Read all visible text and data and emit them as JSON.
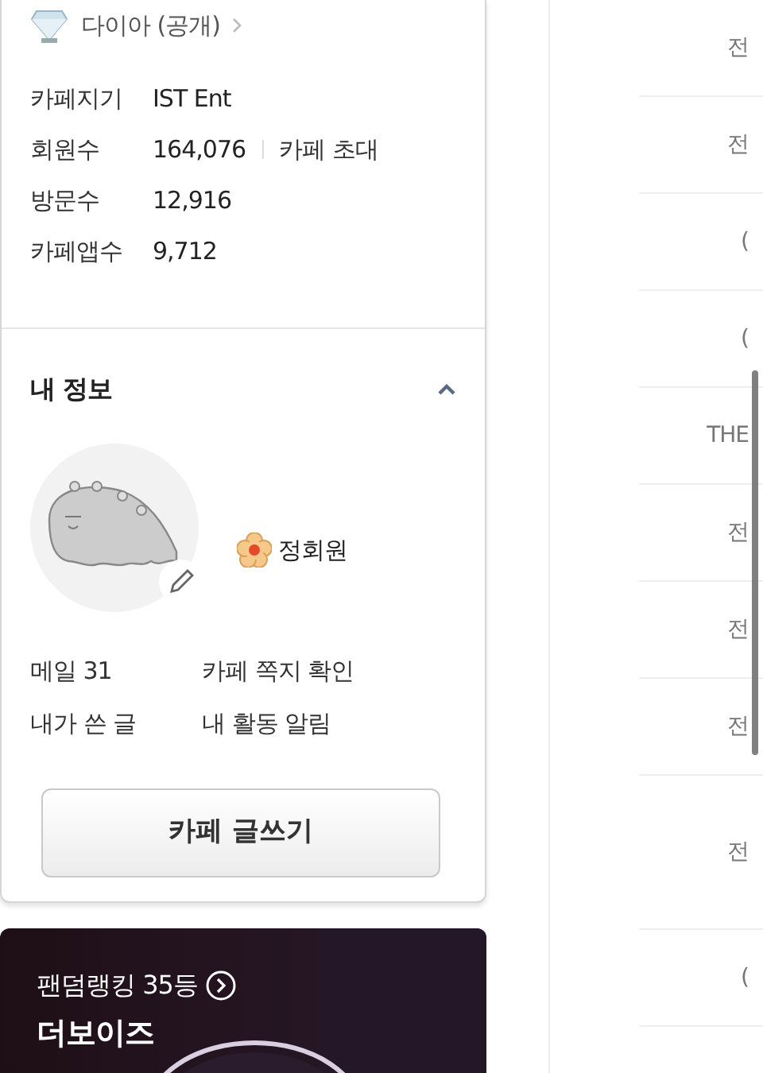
{
  "cafe_info": {
    "grade": "다이아 (공개)",
    "stats": [
      {
        "label": "카페지기",
        "value": "IST Ent"
      },
      {
        "label": "회원수",
        "value": "164,076",
        "action": "카페 초대"
      },
      {
        "label": "방문수",
        "value": "12,916"
      },
      {
        "label": "카페앱수",
        "value": "9,712"
      }
    ]
  },
  "my_info": {
    "title": "내 정보",
    "expanded": true,
    "member_level": "정회원",
    "links": [
      "메일 31",
      "카페 쪽지 확인",
      "내가 쓴 글",
      "내 활동 알림"
    ]
  },
  "write_button": "카페 글쓰기",
  "ranking_banner": {
    "rank": "팬덤랭킹 35등",
    "name": "더보이즈"
  },
  "right_list": {
    "rows": [
      {
        "text": "전",
        "tall": false
      },
      {
        "text": "전",
        "tall": false
      },
      {
        "text": "(",
        "tall": false
      },
      {
        "text": "(",
        "tall": false
      },
      {
        "text": "THE",
        "tall": false
      },
      {
        "text": "전",
        "tall": false
      },
      {
        "text": "전",
        "tall": false
      },
      {
        "text": "전",
        "tall": false
      },
      {
        "text": "전",
        "tall": true
      },
      {
        "text": "(",
        "tall": false
      }
    ]
  }
}
